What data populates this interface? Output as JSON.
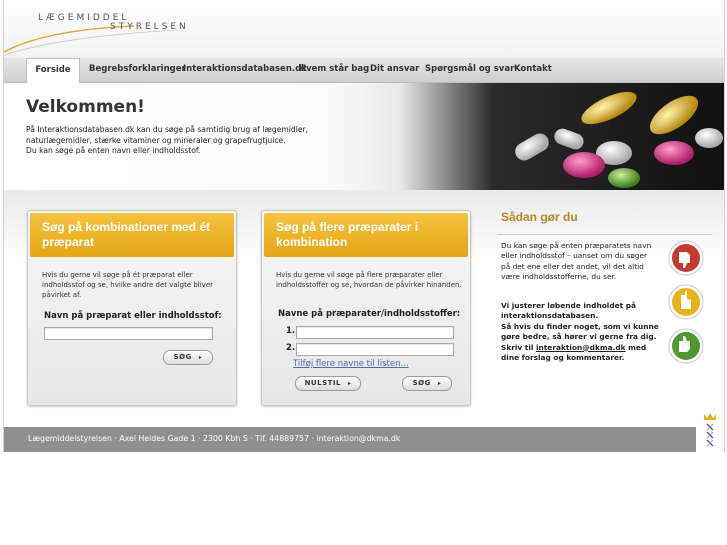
{
  "logo": {
    "line1": "LÆGEMIDDEL",
    "line2": "STYRELSEN"
  },
  "nav": {
    "items": [
      {
        "label": "Forside"
      },
      {
        "label": "Begrebsforklaringer"
      },
      {
        "label": "Interaktionsdatabasen.dk"
      },
      {
        "label": "Hvem står bag"
      },
      {
        "label": "Dit ansvar"
      },
      {
        "label": "Spørgsmål og svar"
      },
      {
        "label": "Kontakt"
      }
    ]
  },
  "hero": {
    "title": "Velkommen!",
    "text1": "På Interaktionsdatabasen.dk kan du søge på samtidig brug af lægemidler, naturlægemidler, stærke vitaminer og mineraler og grapefrugtjuice.",
    "text2": "Du kan søge på enten navn eller indholdsstof."
  },
  "box1": {
    "title": "Søg på kombinationer med ét præparat",
    "desc": "Hvis du gerne vil søge på ét præparat eller indholdsstof og se, hvilke andre det valgte bliver påvirket af.",
    "field_label": "Navn på præparat eller indholdsstof:",
    "search_button": "SØG"
  },
  "box2": {
    "title": "Søg på flere præparater i kombination",
    "desc": "Hvis du gerne vil søge på flere præparater eller indholdsstoffer og se, hvordan de påvirker hinanden.",
    "field_label": "Navne på præparater/indholdsstoffer:",
    "num1": "1.",
    "num2": "2.",
    "add_link": "Tilføj flere navne til listen...",
    "reset_button": "NULSTIL",
    "search_button": "SØG"
  },
  "help": {
    "title": "Sådan gør du",
    "text": "Du kan søge på enten præparatets navn eller indholdsstof – uanset om du søger på det ene eller det andet, vil det altid være indholdsstofferne, du ser.",
    "bold1": "Vi justerer løbende indholdet på interaktionsdatabasen.",
    "bold2": "Så hvis du finder noget, som vi kunne gøre bedre, så hører vi gerne fra dig. Skriv til",
    "email": "interaktion@dkma.dk",
    "bold3": "med dine forslag og kommentarer."
  },
  "footer": {
    "text": "Lægemiddelstyrelsen · Axel Heides Gade 1 · 2300 Kbh S · Tlf. 44889757 · interaktion@dkma.dk"
  },
  "colors": {
    "accent": "#e8a91a",
    "help_title": "#b8882a",
    "footer_bg": "#8f8f8f",
    "link": "#4d6fa8"
  }
}
